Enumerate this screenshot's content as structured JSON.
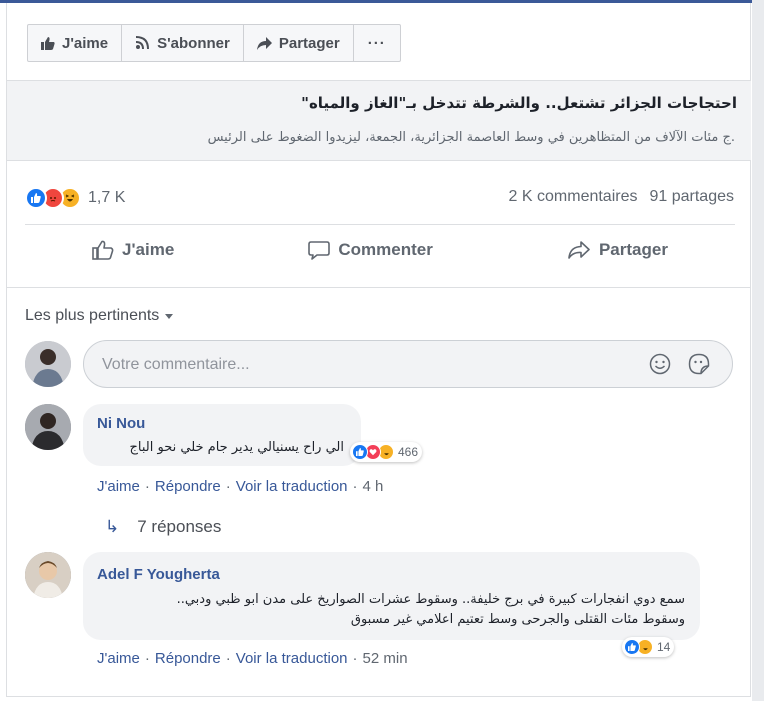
{
  "toolbar": {
    "like_label": "J'aime",
    "subscribe_label": "S'abonner",
    "share_label": "Partager",
    "more_label": "···"
  },
  "preview": {
    "title": "احتجاجات الجزائر تشتعل.. والشرطة تتدخل بـ\"الغاز والمياه\"",
    "description": ".ج مئات الآلاف من المتظاهرين في وسط العاصمة الجزائرية، الجمعة، ليزيدوا الضغوط على الرئيس"
  },
  "stats": {
    "reaction_count": "1,7 K",
    "comments": "2 K commentaires",
    "shares": "91 partages"
  },
  "actions": {
    "like": "J'aime",
    "comment": "Commenter",
    "share": "Partager"
  },
  "sort": {
    "label": "Les plus pertinents"
  },
  "composer": {
    "placeholder": "Votre commentaire..."
  },
  "comments": [
    {
      "author": "Ni Nou",
      "text": "الي راح يسنيالي يدير جام خلي نحو الباج",
      "reaction_count": "466",
      "like_label": "J'aime",
      "reply_label": "Répondre",
      "translate_label": "Voir la traduction",
      "time": "4 h",
      "replies_label": "7 réponses"
    },
    {
      "author": "Adel F Yougherta",
      "text_line1": "سمع دوي انفجارات كبيرة في برج خليفة.. وسقوط عشرات الصواريخ على مدن ابو ظبي ودبي..",
      "text_line2": "وسقوط مئات القتلى والجرحى وسط تعتيم اعلامي غير مسبوق",
      "reaction_count": "14",
      "like_label": "J'aime",
      "reply_label": "Répondre",
      "translate_label": "Voir la traduction",
      "time": "52 min"
    }
  ],
  "colors": {
    "facebook_blue": "#3b5998",
    "link_blue": "#385898",
    "like_blue": "#1877f2",
    "angry_red": "#f0463e",
    "haha_yellow": "#f7b125",
    "love_red": "#f33e58"
  }
}
